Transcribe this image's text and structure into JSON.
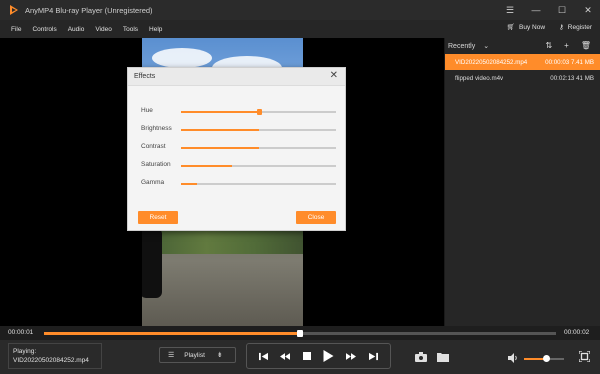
{
  "app": {
    "title": "AnyMP4 Blu-ray Player (Unregistered)",
    "accent": "#ff8c2a"
  },
  "menu": {
    "items": [
      "File",
      "Controls",
      "Audio",
      "Video",
      "Tools",
      "Help"
    ],
    "buy_now": "Buy Now",
    "register": "Register"
  },
  "playlist": {
    "header": "Recently",
    "items": [
      {
        "name": "VID20220502084252.mp4",
        "duration": "00:00:03",
        "size": "7.41 MB",
        "active": true
      },
      {
        "name": "flipped video.m4v",
        "duration": "00:02:13",
        "size": "41 MB",
        "active": false
      }
    ]
  },
  "progress": {
    "current": "00:00:01",
    "total": "00:00:02",
    "fraction": 0.5
  },
  "controls": {
    "playing_label": "Playing:",
    "playing_file": "VID20220502084252.mp4",
    "playlist_label": "Playlist",
    "volume_fraction": 0.55
  },
  "effects": {
    "title": "Effects",
    "sliders": [
      {
        "label": "Hue",
        "value": 0.5
      },
      {
        "label": "Brightness",
        "value": 0.5
      },
      {
        "label": "Contrast",
        "value": 0.5
      },
      {
        "label": "Saturation",
        "value": 0.33
      },
      {
        "label": "Gamma",
        "value": 0.1
      }
    ],
    "reset_label": "Reset",
    "close_label": "Close"
  }
}
